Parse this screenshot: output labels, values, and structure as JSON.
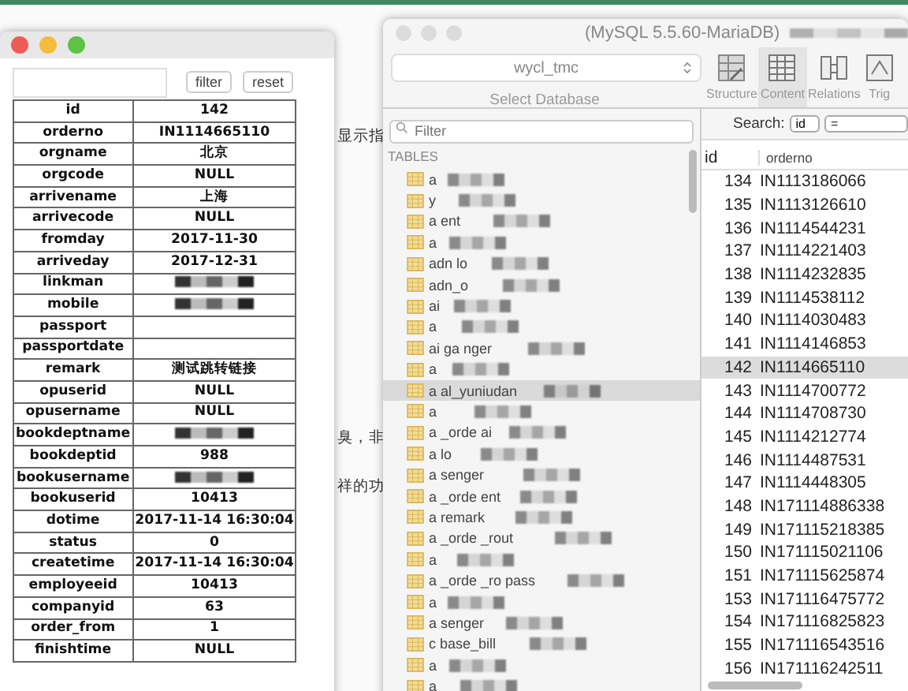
{
  "background": {
    "fragments": [
      "显示指",
      "臭，非",
      "祥的功"
    ]
  },
  "record_window": {
    "buttons": [
      "filter",
      "reset"
    ],
    "fields": [
      {
        "name": "id",
        "value": "142",
        "redacted": false
      },
      {
        "name": "orderno",
        "value": "IN1114665110",
        "redacted": false
      },
      {
        "name": "orgname",
        "value": "北京",
        "redacted": false
      },
      {
        "name": "orgcode",
        "value": "NULL",
        "redacted": false
      },
      {
        "name": "arrivename",
        "value": "上海",
        "redacted": false
      },
      {
        "name": "arrivecode",
        "value": "NULL",
        "redacted": false
      },
      {
        "name": "fromday",
        "value": "2017-11-30",
        "redacted": false
      },
      {
        "name": "arriveday",
        "value": "2017-12-31",
        "redacted": false
      },
      {
        "name": "linkman",
        "redacted": true
      },
      {
        "name": "mobile",
        "redacted": true
      },
      {
        "name": "passport",
        "redacted": false
      },
      {
        "name": "passportdate",
        "redacted": false
      },
      {
        "name": "remark",
        "value": "测试跳转链接",
        "redacted": false
      },
      {
        "name": "opuserid",
        "value": "NULL",
        "redacted": false
      },
      {
        "name": "opusername",
        "value": "NULL",
        "redacted": false
      },
      {
        "name": "bookdeptname",
        "redacted": true
      },
      {
        "name": "bookdeptid",
        "value": "988",
        "redacted": false
      },
      {
        "name": "bookusername",
        "redacted": true
      },
      {
        "name": "bookuserid",
        "value": "10413",
        "redacted": false
      },
      {
        "name": "dotime",
        "value": "2017-11-14 16:30:04",
        "redacted": false
      },
      {
        "name": "status",
        "value": "0",
        "redacted": false
      },
      {
        "name": "createtime",
        "value": "2017-11-14 16:30:04",
        "redacted": false
      },
      {
        "name": "employeeid",
        "value": "10413",
        "redacted": false
      },
      {
        "name": "companyid",
        "value": "63",
        "redacted": false
      },
      {
        "name": "order_from",
        "value": "1",
        "redacted": false
      },
      {
        "name": "finishtime",
        "value": "NULL",
        "redacted": false
      }
    ]
  },
  "db_window": {
    "title": "(MySQL 5.5.60-MariaDB)",
    "database": {
      "value": "wycl_tmc",
      "label": "Select Database"
    },
    "toolbar": [
      {
        "kind": "structure",
        "label": "Structure",
        "selected": false
      },
      {
        "kind": "content",
        "label": "Content",
        "selected": true
      },
      {
        "kind": "relations",
        "label": "Relations",
        "selected": false
      },
      {
        "kind": "triggers",
        "label": "Trig",
        "selected": false
      }
    ],
    "sidebar": {
      "filter": {
        "placeholder": "Filter"
      },
      "heading": "TABLES",
      "items": [
        {
          "label": "a",
          "selected": false,
          "redacted": true
        },
        {
          "label": "y",
          "selected": false,
          "redacted": true
        },
        {
          "label": "a ent",
          "selected": false,
          "redacted": true
        },
        {
          "label": "a",
          "selected": false,
          "redacted": true
        },
        {
          "label": "adn lo",
          "selected": false,
          "redacted": true
        },
        {
          "label": "adn_o",
          "selected": false,
          "redacted": true
        },
        {
          "label": "ai",
          "selected": false,
          "redacted": true
        },
        {
          "label": "a",
          "selected": false,
          "redacted": true
        },
        {
          "label": "ai ga nger",
          "selected": false,
          "redacted": true
        },
        {
          "label": "a",
          "selected": false,
          "redacted": true
        },
        {
          "label": "a al_yuniudan",
          "selected": true,
          "redacted": true
        },
        {
          "label": "a",
          "selected": false,
          "redacted": true
        },
        {
          "label": "a _orde ai",
          "selected": false,
          "redacted": true
        },
        {
          "label": "a lo",
          "selected": false,
          "redacted": true
        },
        {
          "label": "a senger",
          "selected": false,
          "redacted": true
        },
        {
          "label": "a _orde ent",
          "selected": false,
          "redacted": true
        },
        {
          "label": "a remark",
          "selected": false,
          "redacted": true
        },
        {
          "label": "a _orde _rout",
          "selected": false,
          "redacted": true
        },
        {
          "label": "a",
          "selected": false,
          "redacted": true
        },
        {
          "label": "a _orde _ro pass",
          "selected": false,
          "redacted": true
        },
        {
          "label": "a",
          "selected": false,
          "redacted": true
        },
        {
          "label": "a senger",
          "selected": false,
          "redacted": true
        },
        {
          "label": "c base_bill",
          "selected": false,
          "redacted": true
        },
        {
          "label": "a",
          "selected": false,
          "redacted": true
        },
        {
          "label": "a",
          "selected": false,
          "redacted": true
        }
      ]
    },
    "search": {
      "label": "Search:",
      "column": "id",
      "operator": "="
    },
    "table": {
      "columns": [
        "id",
        "orderno"
      ],
      "rows": [
        {
          "cells": [
            "134",
            "IN1113186066"
          ],
          "selected": false
        },
        {
          "cells": [
            "135",
            "IN1113126610"
          ],
          "selected": false
        },
        {
          "cells": [
            "136",
            "IN1114544231"
          ],
          "selected": false
        },
        {
          "cells": [
            "137",
            "IN1114221403"
          ],
          "selected": false
        },
        {
          "cells": [
            "138",
            "IN1114232835"
          ],
          "selected": false
        },
        {
          "cells": [
            "139",
            "IN1114538112"
          ],
          "selected": false
        },
        {
          "cells": [
            "140",
            "IN1114030483"
          ],
          "selected": false
        },
        {
          "cells": [
            "141",
            "IN1114146853"
          ],
          "selected": false
        },
        {
          "cells": [
            "142",
            "IN1114665110"
          ],
          "selected": true
        },
        {
          "cells": [
            "143",
            "IN1114700772"
          ],
          "selected": false
        },
        {
          "cells": [
            "144",
            "IN1114708730"
          ],
          "selected": false
        },
        {
          "cells": [
            "145",
            "IN1114212774"
          ],
          "selected": false
        },
        {
          "cells": [
            "146",
            "IN1114487531"
          ],
          "selected": false
        },
        {
          "cells": [
            "147",
            "IN1114448305"
          ],
          "selected": false
        },
        {
          "cells": [
            "148",
            "IN171114886338"
          ],
          "selected": false
        },
        {
          "cells": [
            "149",
            "IN171115218385"
          ],
          "selected": false
        },
        {
          "cells": [
            "150",
            "IN171115021106"
          ],
          "selected": false
        },
        {
          "cells": [
            "151",
            "IN171115625874"
          ],
          "selected": false
        },
        {
          "cells": [
            "153",
            "IN171116475772"
          ],
          "selected": false
        },
        {
          "cells": [
            "154",
            "IN171116825823"
          ],
          "selected": false
        },
        {
          "cells": [
            "155",
            "IN171116543516"
          ],
          "selected": false
        },
        {
          "cells": [
            "156",
            "IN171116242511"
          ],
          "selected": false
        }
      ]
    }
  }
}
